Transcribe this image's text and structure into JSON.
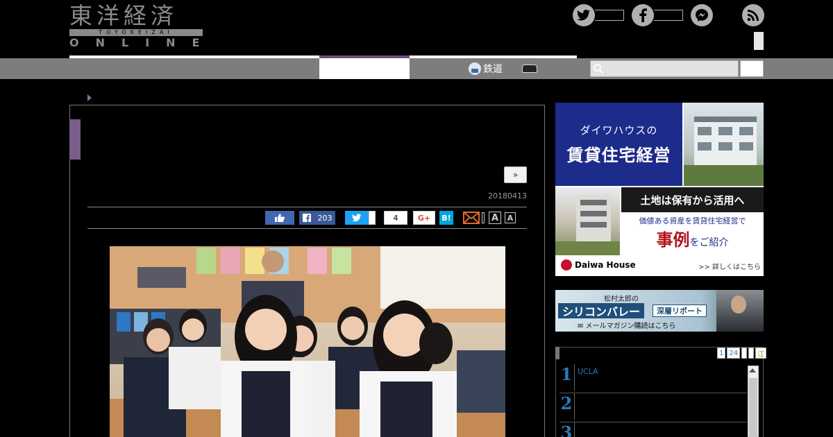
{
  "header": {
    "logo": {
      "kanji": "東洋経済",
      "roman": "TOYOKEIZAI",
      "online": "ONLINE"
    }
  },
  "social": [
    {
      "name": "twitter",
      "glyph": "t"
    },
    {
      "name": "facebook",
      "glyph": "f"
    },
    {
      "name": "messenger",
      "glyph": "m"
    },
    {
      "name": "rss",
      "glyph": "rss"
    }
  ],
  "nav": {
    "items": [
      {
        "label": "鉄道",
        "icon": "train-icon"
      },
      {
        "label": "",
        "icon": "car-icon"
      }
    ],
    "search": {
      "placeholder": "",
      "value": ""
    }
  },
  "article": {
    "more_label": "»",
    "date": "20180413",
    "share": {
      "facebook_count": "203",
      "pocket_count": "4",
      "google_plus": "G+",
      "hatena": "B!"
    },
    "font_sizes": [
      "A",
      "A"
    ]
  },
  "ads": {
    "daiwa": {
      "line1": "ダイワハウスの",
      "line2": "賃貸住宅経営",
      "headline": "土地は保有から活用へ",
      "sub": "価値ある資産を賃貸住宅経営で",
      "case_big": "事例",
      "case_rest": "をご紹介",
      "brand": "Daiwa House",
      "more": ">> 詳しくはこちら"
    },
    "silicon": {
      "small": "松村太郎の",
      "main": "シリコンバレー",
      "tag": "深層リポート",
      "mail": "✉ メールマガジン購読はこちら"
    }
  },
  "ranking": {
    "tabs": [
      "1",
      "24",
      "",
      "",
      "江"
    ],
    "items": [
      {
        "num": "1",
        "text": "UCLA"
      },
      {
        "num": "2",
        "text": ""
      },
      {
        "num": "3",
        "text": ""
      }
    ]
  },
  "colors": {
    "accent_purple": "#7a5d8a",
    "nav_gray": "#7d7d7d",
    "daiwa_blue": "#1d2b8a",
    "rank_blue": "#2a7ab8"
  }
}
